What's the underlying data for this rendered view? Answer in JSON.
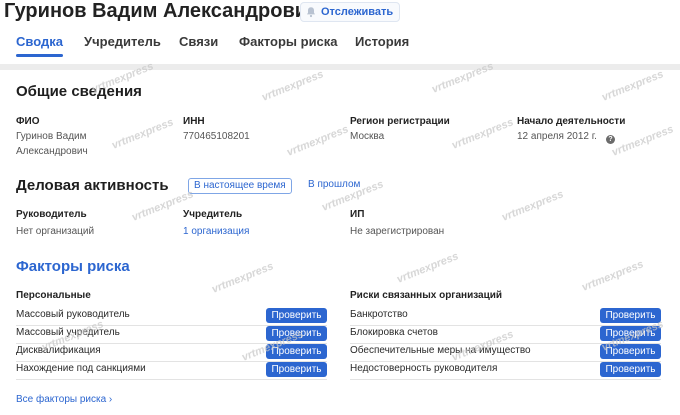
{
  "header": {
    "title": "Гуринов Вадим Александрович",
    "follow_button": "Отслеживать",
    "tabs": [
      "Сводка",
      "Учредитель",
      "Связи",
      "Факторы риска",
      "История"
    ]
  },
  "general": {
    "title": "Общие сведения",
    "fio_label": "ФИО",
    "fio_value_line1": "Гуринов Вадим",
    "fio_value_line2": "Александрович",
    "inn_label": "ИНН",
    "inn_value": "770465108201",
    "region_label": "Регион регистрации",
    "region_value": "Москва",
    "start_label": "Начало деятельности",
    "start_value": "12 апреля 2012 г."
  },
  "business": {
    "title": "Деловая активность",
    "toggle_current": "В настоящее время",
    "toggle_past": "В прошлом",
    "manager_label": "Руководитель",
    "manager_value": "Нет организаций",
    "founder_label": "Учредитель",
    "founder_value": "1 организация",
    "ip_label": "ИП",
    "ip_value": "Не зарегистрирован"
  },
  "risks": {
    "title": "Факторы риска",
    "personal_title": "Персональные",
    "personal": [
      "Массовый руководитель",
      "Массовый учредитель",
      "Дисквалификация",
      "Нахождение под санкциями"
    ],
    "related_title": "Риски связанных организаций",
    "related": [
      "Банкротство",
      "Блокировка счетов",
      "Обеспечительные меры на имущество",
      "Недостоверность руководителя"
    ],
    "check_label": "Проверить",
    "all_link": "Все факторы риска ›"
  },
  "watermark": "vrtmexpress",
  "colors": {
    "accent": "#2c66d0",
    "background": "#ececec",
    "card": "#ffffff"
  }
}
